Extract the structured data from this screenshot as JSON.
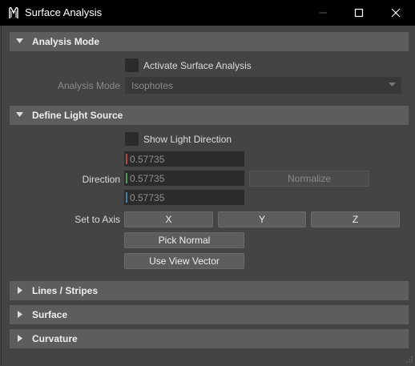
{
  "window": {
    "title": "Surface Analysis",
    "icon": "maya-app-icon",
    "controls": [
      "minimize-icon",
      "maximize-icon",
      "close-icon"
    ]
  },
  "sections": {
    "analysis_mode": {
      "title": "Analysis Mode",
      "expanded": true,
      "activate_label": "Activate Surface Analysis",
      "activate_checked": false,
      "mode_label": "Analysis Mode",
      "mode_value": "Isophotes"
    },
    "light_source": {
      "title": "Define Light Source",
      "expanded": true,
      "show_direction_label": "Show Light Direction",
      "show_direction_checked": false,
      "direction_label": "Direction",
      "direction_x": "0.57735",
      "direction_y": "0.57735",
      "direction_z": "0.57735",
      "normalize_label": "Normalize",
      "set_axis_label": "Set to Axis",
      "axis_x": "X",
      "axis_y": "Y",
      "axis_z": "Z",
      "pick_normal_label": "Pick Normal",
      "use_view_vector_label": "Use View Vector"
    },
    "lines_stripes": {
      "title": "Lines / Stripes",
      "expanded": false
    },
    "surface": {
      "title": "Surface",
      "expanded": false
    },
    "curvature": {
      "title": "Curvature",
      "expanded": false
    }
  },
  "colors": {
    "x_axis": "#b04a4a",
    "y_axis": "#4e9a5a",
    "z_axis": "#4a7fa8"
  }
}
